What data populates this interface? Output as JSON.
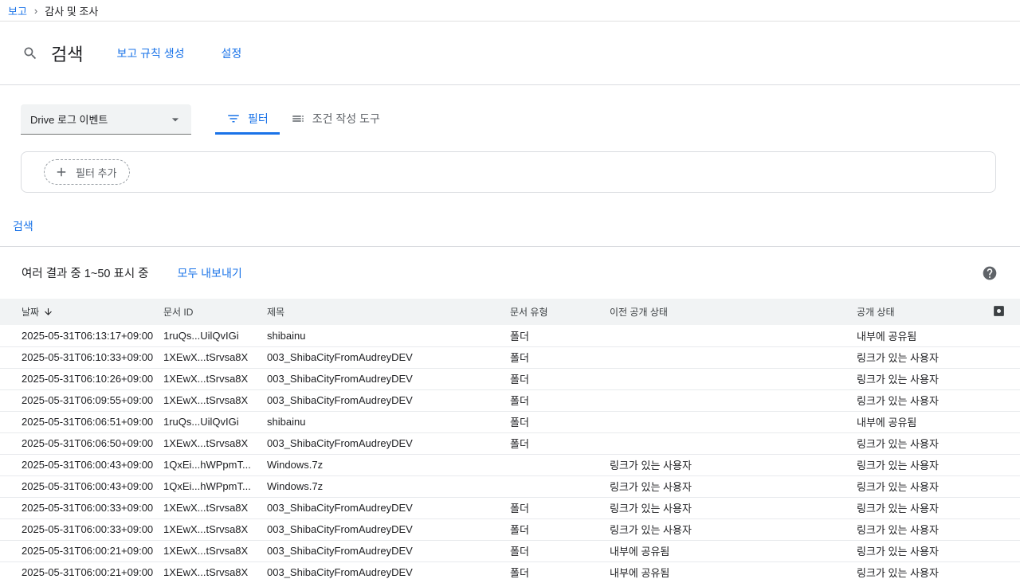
{
  "colors": {
    "accent": "#1a73e8",
    "table_header_bg": "#f1f3f4",
    "text_primary": "#202124",
    "text_secondary": "#5f6368",
    "border": "#dadce0"
  },
  "breadcrumb": {
    "section": "보고",
    "separator": "›",
    "page": "감사 및 조사"
  },
  "header": {
    "title": "검색",
    "create_rule_link": "보고 규칙 생성",
    "settings_link": "설정"
  },
  "query_builder": {
    "data_source": "Drive 로그 이벤트",
    "tabs": [
      {
        "label": "필터"
      },
      {
        "label": "조건 작성 도구"
      }
    ],
    "add_filter_label": "필터 추가",
    "search_button": "검색"
  },
  "results": {
    "summary": "여러 결과 중 1~50 표시 중",
    "export_all_label": "모두 내보내기"
  },
  "table": {
    "columns": {
      "date": "날짜",
      "doc_id": "문서 ID",
      "title": "제목",
      "doc_type": "문서 유형",
      "prev_visibility": "이전 공개 상태",
      "visibility": "공개 상태"
    },
    "rows": [
      {
        "date": "2025-05-31T06:13:17+09:00",
        "doc_id": "1ruQs...UilQvIGi",
        "title": "shibainu",
        "doc_type": "폴더",
        "prev_visibility": "",
        "visibility": "내부에 공유됨"
      },
      {
        "date": "2025-05-31T06:10:33+09:00",
        "doc_id": "1XEwX...tSrvsa8X",
        "title": "003_ShibaCityFromAudreyDEV",
        "doc_type": "폴더",
        "prev_visibility": "",
        "visibility": "링크가 있는 사용자"
      },
      {
        "date": "2025-05-31T06:10:26+09:00",
        "doc_id": "1XEwX...tSrvsa8X",
        "title": "003_ShibaCityFromAudreyDEV",
        "doc_type": "폴더",
        "prev_visibility": "",
        "visibility": "링크가 있는 사용자"
      },
      {
        "date": "2025-05-31T06:09:55+09:00",
        "doc_id": "1XEwX...tSrvsa8X",
        "title": "003_ShibaCityFromAudreyDEV",
        "doc_type": "폴더",
        "prev_visibility": "",
        "visibility": "링크가 있는 사용자"
      },
      {
        "date": "2025-05-31T06:06:51+09:00",
        "doc_id": "1ruQs...UilQvIGi",
        "title": "shibainu",
        "doc_type": "폴더",
        "prev_visibility": "",
        "visibility": "내부에 공유됨"
      },
      {
        "date": "2025-05-31T06:06:50+09:00",
        "doc_id": "1XEwX...tSrvsa8X",
        "title": "003_ShibaCityFromAudreyDEV",
        "doc_type": "폴더",
        "prev_visibility": "",
        "visibility": "링크가 있는 사용자"
      },
      {
        "date": "2025-05-31T06:00:43+09:00",
        "doc_id": "1QxEi...hWPpmT...",
        "title": "Windows.7z",
        "doc_type": "",
        "prev_visibility": "링크가 있는 사용자",
        "visibility": "링크가 있는 사용자"
      },
      {
        "date": "2025-05-31T06:00:43+09:00",
        "doc_id": "1QxEi...hWPpmT...",
        "title": "Windows.7z",
        "doc_type": "",
        "prev_visibility": "링크가 있는 사용자",
        "visibility": "링크가 있는 사용자"
      },
      {
        "date": "2025-05-31T06:00:33+09:00",
        "doc_id": "1XEwX...tSrvsa8X",
        "title": "003_ShibaCityFromAudreyDEV",
        "doc_type": "폴더",
        "prev_visibility": "링크가 있는 사용자",
        "visibility": "링크가 있는 사용자"
      },
      {
        "date": "2025-05-31T06:00:33+09:00",
        "doc_id": "1XEwX...tSrvsa8X",
        "title": "003_ShibaCityFromAudreyDEV",
        "doc_type": "폴더",
        "prev_visibility": "링크가 있는 사용자",
        "visibility": "링크가 있는 사용자"
      },
      {
        "date": "2025-05-31T06:00:21+09:00",
        "doc_id": "1XEwX...tSrvsa8X",
        "title": "003_ShibaCityFromAudreyDEV",
        "doc_type": "폴더",
        "prev_visibility": "내부에 공유됨",
        "visibility": "링크가 있는 사용자"
      },
      {
        "date": "2025-05-31T06:00:21+09:00",
        "doc_id": "1XEwX...tSrvsa8X",
        "title": "003_ShibaCityFromAudreyDEV",
        "doc_type": "폴더",
        "prev_visibility": "내부에 공유됨",
        "visibility": "링크가 있는 사용자"
      }
    ]
  }
}
